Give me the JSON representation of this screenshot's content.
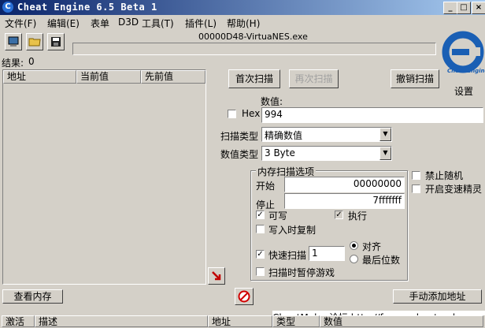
{
  "window": {
    "title": "Cheat Engine 6.5 Beta 1",
    "process": "00000D48-VirtuaNES.exe"
  },
  "menu": [
    "文件(F)",
    "编辑(E)",
    "表单",
    "D3D",
    "工具(T)",
    "插件(L)",
    "帮助(H)"
  ],
  "results": {
    "label": "结果:",
    "count": "0"
  },
  "found_list": {
    "columns": [
      "地址",
      "当前值",
      "先前值"
    ]
  },
  "scan": {
    "first_scan": "首次扫描",
    "next_scan": "再次扫描",
    "undo_scan": "撤销扫描",
    "settings": "设置",
    "logo_text": "Cheat Engine"
  },
  "value": {
    "label": "数值:",
    "hex_label": "Hex",
    "hex_checked": false,
    "value": "994"
  },
  "scan_type": {
    "label": "扫描类型",
    "selected": "精确数值"
  },
  "value_type": {
    "label": "数值类型",
    "selected": "3 Byte"
  },
  "memory_options": {
    "title": "内存扫描选项",
    "start_label": "开始",
    "start_value": "00000000",
    "stop_label": "停止",
    "stop_value": "7fffffff",
    "writable_label": "可写",
    "writable_checked": true,
    "executable_label": "执行",
    "executable_checked": true,
    "copy_on_write_label": "写入时复制",
    "copy_on_write_checked": false,
    "fast_scan_label": "快速扫描",
    "fast_scan_checked": true,
    "fast_scan_value": "1",
    "align_label": "对齐",
    "last_digits_label": "最后位数",
    "align_selected": "对齐",
    "pause_label": "扫描时暂停游戏",
    "pause_checked": false
  },
  "side_options": {
    "no_random_label": "禁止随机",
    "no_random_checked": false,
    "speedhack_label": "开启变速精灵",
    "speedhack_checked": false
  },
  "bottom": {
    "view_memory": "查看内存",
    "add_address_manually": "手动添加地址",
    "footer_text": "CheatMaker论坛 http://forum.cheatmaker.org)"
  },
  "address_list": {
    "columns": [
      "激活",
      "描述",
      "地址",
      "类型",
      "数值"
    ]
  },
  "colors": {
    "title_start": "#0a246a",
    "title_end": "#a6caf0",
    "face": "#d4d0c8",
    "logo": "#1a5fb4"
  }
}
